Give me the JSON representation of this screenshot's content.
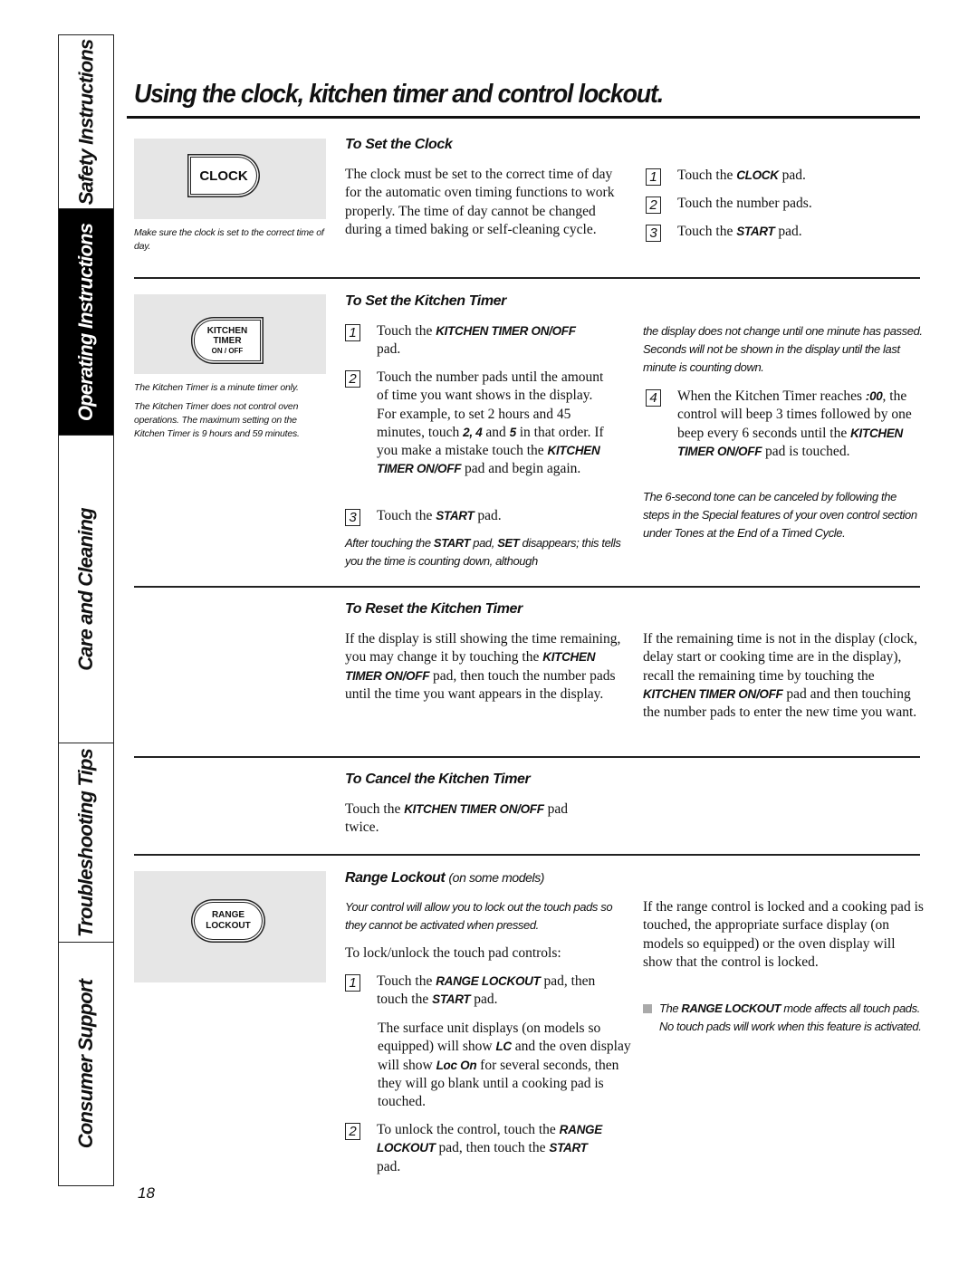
{
  "side_tabs": [
    {
      "label": "Safety Instructions",
      "active": false
    },
    {
      "label": "Operating Instructions",
      "active": true
    },
    {
      "label": "Care and Cleaning",
      "active": false
    },
    {
      "label": "Troubleshooting Tips",
      "active": false
    },
    {
      "label": "Consumer Support",
      "active": false
    }
  ],
  "page_title": "Using the clock, kitchen timer and control lockout.",
  "page_number": "18",
  "pads": {
    "clock": "CLOCK",
    "kitchen_timer": [
      "KITCHEN",
      "TIMER",
      "ON / OFF"
    ],
    "range_lockout": [
      "RANGE",
      "LOCKOUT"
    ]
  },
  "set_clock": {
    "heading": "To Set the Clock",
    "caption": "Make sure the clock is set to the correct time of day.",
    "body": "The clock must be set to the correct time of day for the automatic oven timing functions to work properly. The time of day cannot be changed during a timed baking or self-cleaning cycle.",
    "steps": [
      {
        "n": "1",
        "pre": "Touch the ",
        "key": "CLOCK",
        "post": " pad."
      },
      {
        "n": "2",
        "pre": "Touch the number pads.",
        "key": "",
        "post": ""
      },
      {
        "n": "3",
        "pre": "Touch the ",
        "key": "START",
        "post": " pad."
      }
    ]
  },
  "set_timer": {
    "heading": "To Set the Kitchen Timer",
    "caption1": "The Kitchen Timer is a minute timer only.",
    "caption2": "The Kitchen Timer does not control oven operations. The maximum setting on the Kitchen Timer is 9 hours and 59 minutes.",
    "step1": {
      "n": "1",
      "pre": "Touch the ",
      "key": "KITCHEN TIMER ON/OFF",
      "post": " pad."
    },
    "step2": {
      "n": "2",
      "a": "Touch the number pads until the amount of time you want shows in the display. For example, to set 2 hours and 45 minutes, touch ",
      "k1": "2, 4",
      "b": " and ",
      "k2": "5",
      "c": " in that order. If you make a mistake touch the ",
      "k3": "KITCHEN TIMER ON/OFF",
      "d": " pad and begin again."
    },
    "step3": {
      "n": "3",
      "pre": "Touch the ",
      "key": "START",
      "post": " pad."
    },
    "note": {
      "a": "After touching the ",
      "k1": "START",
      "b": " pad, ",
      "k2": "SET",
      "c": " disappears; this tells you the time is counting down, although the display does not change until one minute has passed. Seconds will not be shown in the display until the last minute is counting down."
    },
    "step4": {
      "n": "4",
      "a": "When the Kitchen Timer reaches ",
      "k1": ":00",
      "b": ", the control will beep 3 times followed by one beep every 6 seconds until the ",
      "k2": "KITCHEN TIMER ON/OFF",
      "c": " pad is touched."
    },
    "tone_note": "The 6-second tone can be canceled by following the steps in the Special features of your oven control section under Tones at the End of a Timed Cycle."
  },
  "reset_timer": {
    "heading": "To Reset the Kitchen Timer",
    "left": {
      "a": "If the display is still showing the time remaining, you may change it by touching the ",
      "key": "KITCHEN TIMER ON/OFF",
      "b": " pad, then touch the number pads until the time you want appears in the display."
    },
    "right": {
      "a": "If the remaining time is not in the display (clock, delay start or cooking time are in the display), recall the remaining time by touching the ",
      "key": "KITCHEN TIMER ON/OFF",
      "b": " pad and then touching the number pads to enter the new time you want."
    }
  },
  "cancel_timer": {
    "heading": "To Cancel the Kitchen Timer",
    "pre": "Touch the ",
    "key": "KITCHEN TIMER ON/OFF",
    "post": " pad twice."
  },
  "range_lockout": {
    "heading": "Range Lockout",
    "heading_sub": "(on some models)",
    "intro": "Your control will allow you to lock out the touch pads so they cannot be activated when pressed.",
    "lead": "To lock/unlock the touch pad controls:",
    "step1": {
      "n": "1",
      "a": "Touch the ",
      "k1": "RANGE LOCKOUT",
      "b": " pad, then touch the ",
      "k2": "START",
      "c": " pad."
    },
    "step1_detail": {
      "a": "The surface unit displays (on models so equipped) will show ",
      "k1": "LC",
      "b": " and the oven display will show ",
      "k2": "Loc On",
      "c": " for several seconds, then they will go blank until a cooking pad is touched."
    },
    "step2": {
      "n": "2",
      "a": "To unlock the control, touch the ",
      "k1": "RANGE LOCKOUT",
      "b": " pad, then touch the ",
      "k2": "START",
      "c": " pad."
    },
    "right_body": "If the range control is locked and a cooking pad is touched, the appropriate surface display (on models so equipped) or the oven display will show that the control is locked.",
    "bullet": {
      "a": "The ",
      "key": "RANGE LOCKOUT",
      "b": " mode affects all touch pads. No touch pads will work when this feature is activated."
    }
  }
}
